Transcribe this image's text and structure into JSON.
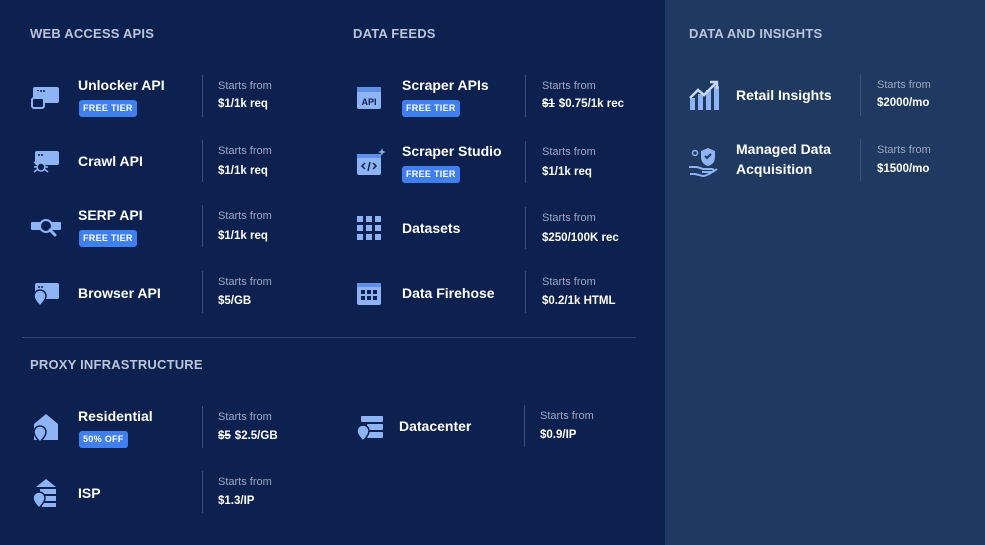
{
  "sections": {
    "web_access": "WEB ACCESS APIS",
    "data_feeds": "DATA FEEDS",
    "insights": "DATA AND INSIGHTS",
    "proxy": "PROXY INFRASTRUCTURE"
  },
  "starts_from": "Starts from",
  "web_access": [
    {
      "name": "Unlocker API",
      "badge": "FREE TIER",
      "price": "$1/1k req",
      "icon": "unlocker-icon"
    },
    {
      "name": "Crawl API",
      "price": "$1/1k req",
      "icon": "spider-icon"
    },
    {
      "name": "SERP API",
      "badge": "FREE TIER",
      "price": "$1/1k req",
      "icon": "serp-search-icon"
    },
    {
      "name": "Browser API",
      "price": "$5/GB",
      "icon": "browser-icon"
    }
  ],
  "data_feeds": [
    {
      "name": "Scraper APIs",
      "badge": "FREE TIER",
      "price_old": "$1",
      "price": "$0.75/1k rec",
      "icon": "api-icon"
    },
    {
      "name": "Scraper Studio",
      "badge": "FREE TIER",
      "price": "$1/1k req",
      "icon": "code-sparkle-icon"
    },
    {
      "name": "Datasets",
      "price": "$250/100K rec",
      "icon": "grid-icon"
    },
    {
      "name": "Data Firehose",
      "price": "$0.2/1k HTML",
      "icon": "table-window-icon"
    }
  ],
  "proxy": [
    {
      "name": "Residential",
      "badge": "50% OFF",
      "price_old": "$5",
      "price": "$2.5/GB",
      "icon": "house-pin-icon"
    },
    {
      "name": "Datacenter",
      "price": "$0.9/IP",
      "icon": "server-pin-icon"
    },
    {
      "name": "ISP",
      "price": "$1.3/IP",
      "icon": "isp-pin-icon"
    }
  ],
  "insights": [
    {
      "name_line1": "Retail Insights",
      "price": "$2000/mo",
      "icon": "chart-growth-icon"
    },
    {
      "name_line1": "Managed Data",
      "name_line2": "Acquisition",
      "price": "$1500/mo",
      "icon": "hand-shield-icon"
    }
  ],
  "colors": {
    "bg_left": "#0c2150",
    "bg_right": "#1f3960",
    "accent": "#3f7ff0",
    "icon": "#8fb4f5"
  }
}
